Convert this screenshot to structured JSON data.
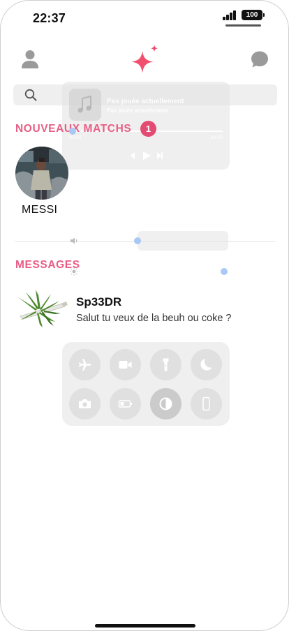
{
  "status": {
    "time": "22:37",
    "battery": "100"
  },
  "header": {
    "profile_icon": "person-icon",
    "logo_icon": "sparkle-icon",
    "chat_icon": "chat-bubble-icon",
    "accent_color": "#f0506e"
  },
  "search": {
    "placeholder": "",
    "icon": "search-icon"
  },
  "media_widget": {
    "title": "Pas jouée actuellement",
    "subtitle": "Pas jouée actuellement",
    "elapsed": "00:00",
    "remaining": "00:00"
  },
  "new_matches": {
    "label": "NOUVEAUX MATCHS",
    "count": "1",
    "items": [
      {
        "name": "MESSI"
      }
    ]
  },
  "messages": {
    "label": "MESSAGES",
    "items": [
      {
        "name": "Sp33DR",
        "preview": "Salut tu veux de la beuh ou coke ?"
      }
    ]
  },
  "control_center": {
    "buttons": [
      "airplane-icon",
      "camera-video-icon",
      "flashlight-icon",
      "moon-icon",
      "camera-icon",
      "battery-icon",
      "dark-mode-icon",
      "phone-icon"
    ]
  },
  "colors": {
    "section_label": "#e85d84",
    "badge": "#e34b72",
    "slider_dot": "#a9c9f4"
  }
}
